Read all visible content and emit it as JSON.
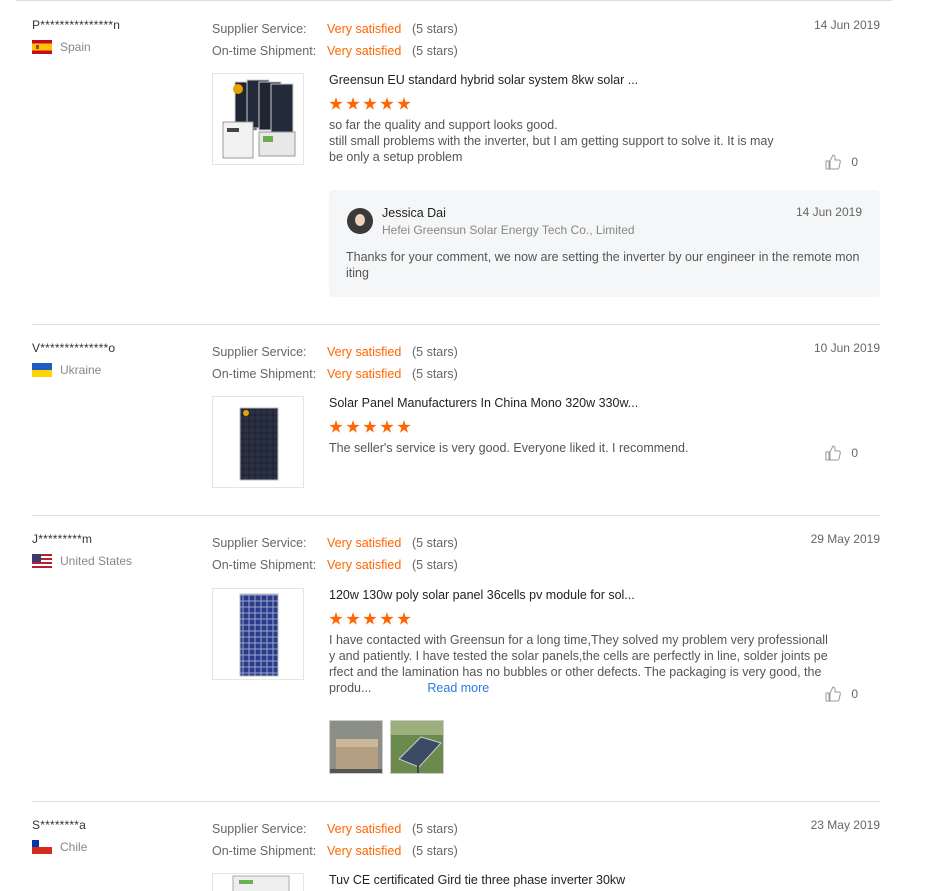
{
  "rating_labels": {
    "service": "Supplier Service:",
    "shipment": "On-time Shipment:"
  },
  "reviews": [
    {
      "buyer": "P***************n",
      "country": "Spain",
      "service": {
        "value": "Very satisfied",
        "stars": "(5 stars)"
      },
      "shipment": {
        "value": "Very satisfied",
        "stars": "(5 stars)"
      },
      "date": "14 Jun 2019",
      "product": "Greensun EU standard hybrid solar system 8kw solar ...",
      "rating": 5,
      "comment": "so far the quality and support looks good.\nstill small problems with the inverter, but I am getting support to solve it. It is maybe only a setup problem",
      "likes": "0",
      "reply": {
        "name": "Jessica Dai",
        "company": "Hefei Greensun Solar Energy Tech Co., Limited",
        "date": "14 Jun 2019",
        "text": "Thanks for your comment, we now are setting the inverter by our engineer in the remote moniting"
      }
    },
    {
      "buyer": "V**************o",
      "country": "Ukraine",
      "service": {
        "value": "Very satisfied",
        "stars": "(5 stars)"
      },
      "shipment": {
        "value": "Very satisfied",
        "stars": "(5 stars)"
      },
      "date": "10 Jun 2019",
      "product": "Solar Panel Manufacturers In China Mono 320w 330w...",
      "rating": 5,
      "comment": "The seller's service is very good. Everyone liked it. I recommend.",
      "likes": "0"
    },
    {
      "buyer": "J*********m",
      "country": "United States",
      "service": {
        "value": "Very satisfied",
        "stars": "(5 stars)"
      },
      "shipment": {
        "value": "Very satisfied",
        "stars": "(5 stars)"
      },
      "date": "29 May 2019",
      "product": "120w 130w poly solar panel 36cells pv module for sol...",
      "rating": 5,
      "comment": "I have contacted with Greensun for a long time,They solved my problem very professionally and patiently. I have tested the solar panels,the cells are perfectly in line, solder joints perfect and the lamination has no bubbles or other defects. The packaging is very good, the produ...",
      "read_more": "Read more",
      "likes": "0"
    },
    {
      "buyer": "S********a",
      "country": "Chile",
      "service": {
        "value": "Very satisfied",
        "stars": "(5 stars)"
      },
      "shipment": {
        "value": "Very satisfied",
        "stars": "(5 stars)"
      },
      "date": "23 May 2019",
      "product": "Tuv CE certificated Gird tie three phase inverter 30kw"
    }
  ]
}
